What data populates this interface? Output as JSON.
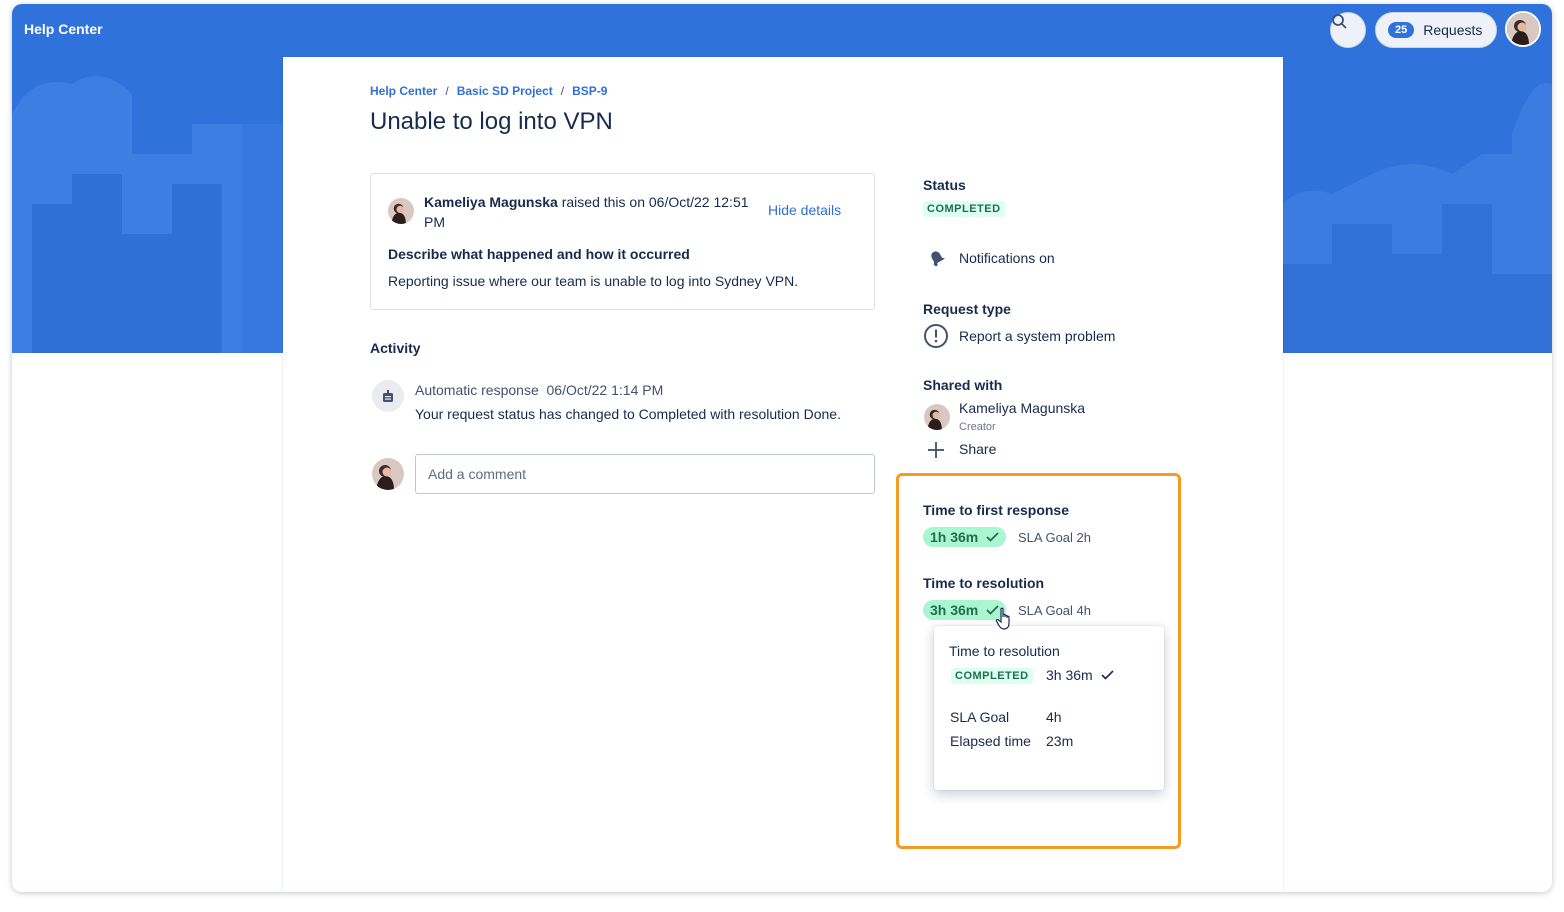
{
  "header": {
    "title": "Help Center",
    "requests_count": "25",
    "requests_label": "Requests"
  },
  "breadcrumb": [
    "Help Center",
    "Basic SD Project",
    "BSP-9"
  ],
  "page_title": "Unable to log into VPN",
  "details": {
    "author": "Kameliya Magunska",
    "raised_text": " raised this on 06/Oct/22 12:51 PM",
    "hide_details": "Hide details",
    "question": "Describe what happened and how it occurred",
    "answer": "Reporting issue where our team is unable to log into Sydney VPN."
  },
  "activity": {
    "heading": "Activity",
    "auto_label": "Automatic response",
    "auto_time": "06/Oct/22 1:14 PM",
    "auto_message": "Your request status has changed to Completed with resolution Done.",
    "comment_placeholder": "Add a comment"
  },
  "sidebar": {
    "status_heading": "Status",
    "status_value": "COMPLETED",
    "notifications": "Notifications on",
    "request_type_heading": "Request type",
    "request_type": "Report a system problem",
    "shared_heading": "Shared with",
    "shared_name": "Kameliya Magunska",
    "shared_role": "Creator",
    "share_label": "Share"
  },
  "sla": {
    "first_response": {
      "heading": "Time to first response",
      "value": "1h 36m",
      "goal": "SLA Goal 2h"
    },
    "resolution": {
      "heading": "Time to resolution",
      "value": "3h 36m",
      "goal": "SLA Goal 4h"
    }
  },
  "tooltip": {
    "heading": "Time to resolution",
    "status": "COMPLETED",
    "value": "3h 36m",
    "goal_label": "SLA Goal",
    "goal_value": "4h",
    "elapsed_label": "Elapsed time",
    "elapsed_value": "23m"
  },
  "colors": {
    "banner": "#2f72dc",
    "link": "#2f6fd8",
    "success_bg": "#abf5d1",
    "success_text": "#216e4e",
    "highlight": "#f79a23"
  }
}
